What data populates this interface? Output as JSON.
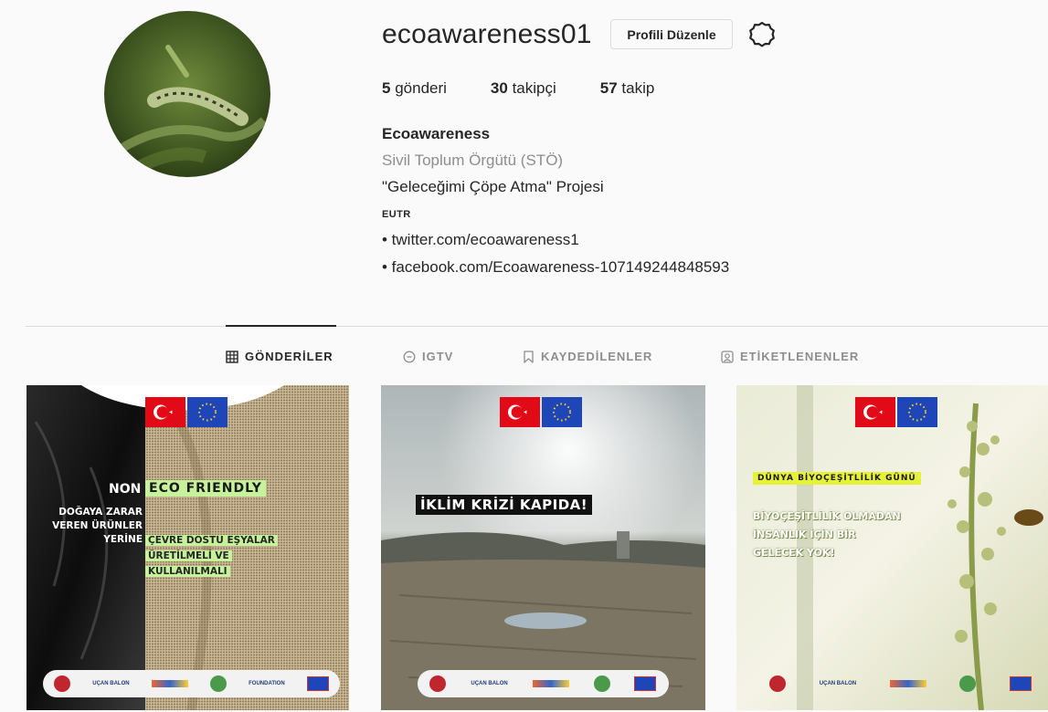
{
  "profile": {
    "username": "ecoawareness01",
    "edit_button": "Profili Düzenle",
    "settings_icon": "gear-icon",
    "stats": [
      {
        "count": "5",
        "label": "gönderi"
      },
      {
        "count": "30",
        "label": "takipçi"
      },
      {
        "count": "57",
        "label": "takip"
      }
    ],
    "bio": {
      "name": "Ecoawareness",
      "category": "Sivil Toplum Örgütü (STÖ)",
      "line1": "\"Geleceğimi Çöpe Atma\" Projesi",
      "line2": "EUTR",
      "link1": "• twitter.com/ecoawareness1",
      "link2": "• facebook.com/Ecoawareness-107149244848593"
    }
  },
  "tabs": [
    {
      "label": "GÖNDERİLER",
      "icon": "grid-icon",
      "active": true
    },
    {
      "label": "IGTV",
      "icon": "igtv-icon",
      "active": false
    },
    {
      "label": "KAYDEDİLENLER",
      "icon": "bookmark-icon",
      "active": false
    },
    {
      "label": "ETİKETLENENLER",
      "icon": "tag-icon",
      "active": false
    }
  ],
  "posts": [
    {
      "non": "NON",
      "eco": "ECO FRIENDLY",
      "left_lines": [
        "DOĞAYA ZARAR",
        "VEREN ÜRÜNLER",
        "YERİNE"
      ],
      "right_lines": [
        "ÇEVRE DOSTU EŞYALAR",
        "ÜRETİLMELİ VE",
        "KULLANILMALI"
      ]
    },
    {
      "title": "İKLİM KRİZİ KAPIDA!"
    },
    {
      "day": "DÜNYA BİYOÇEŞİTLİLİK GÜNÜ",
      "lines": [
        "BİYOÇEŞİTLİLİK OLMADAN",
        "İNSANLIK İÇİN BİR",
        "GELECEK YOK!"
      ]
    }
  ],
  "sponsors": [
    "UÇAN BALON",
    "SİVİL TOPLUM SEKTÖRÜ",
    "FOUNDATION"
  ],
  "colors": {
    "text": "#262626",
    "muted": "#8e8e8e",
    "border": "#dbdbdb",
    "eco_green": "#c5f29a",
    "turkey_red": "#e30a17",
    "eu_blue": "#1f46b8"
  }
}
